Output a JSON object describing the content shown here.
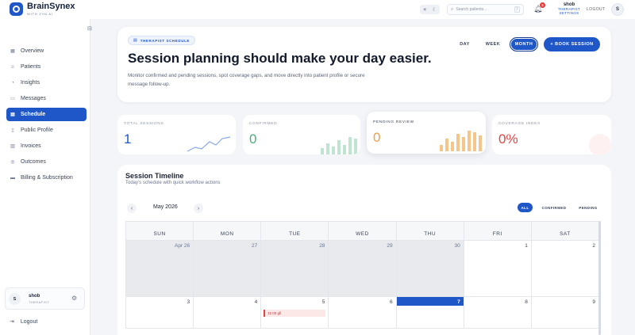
{
  "app": {
    "name": "BrainSynex",
    "tagline": "WITH ZYN AI"
  },
  "topbar": {
    "search_placeholder": "Search patients...",
    "search_shortcut": "/",
    "notification_count": "2",
    "user_name": "shob",
    "user_role": "THERAPIST SETTINGS",
    "logout_label": "LOGOUT",
    "avatar_initial": "S"
  },
  "sidebar": {
    "items": [
      {
        "label": "Overview",
        "icon": "grid-icon",
        "active": false
      },
      {
        "label": "Patients",
        "icon": "users-icon",
        "active": false
      },
      {
        "label": "Insights",
        "icon": "lightbulb-icon",
        "active": false
      },
      {
        "label": "Messages",
        "icon": "chat-icon",
        "active": false
      },
      {
        "label": "Schedule",
        "icon": "calendar-icon",
        "active": true
      },
      {
        "label": "Public Profile",
        "icon": "profile-icon",
        "active": false
      },
      {
        "label": "Invoices",
        "icon": "invoice-icon",
        "active": false
      },
      {
        "label": "Outcomes",
        "icon": "target-icon",
        "active": false
      },
      {
        "label": "Billing & Subscription",
        "icon": "card-icon",
        "active": false
      }
    ],
    "user": {
      "initial": "S",
      "name": "shob",
      "role": "THERAPIST"
    },
    "logout_label": "Logout"
  },
  "hero": {
    "tag": "THERAPIST SCHEDULE",
    "title": "Session planning should make your day easier.",
    "description": "Monitor confirmed and pending sessions, spot coverage gaps, and move directly into patient profile or secure message follow-up.",
    "range_buttons": [
      "DAY",
      "WEEK",
      "MONTH"
    ],
    "selected_range": "MONTH",
    "book_label": "+ BOOK SESSION"
  },
  "stats": [
    {
      "label": "TOTAL SESSIONS",
      "value": "1",
      "color": "#1f57c9"
    },
    {
      "label": "CONFIRMED",
      "value": "0",
      "color": "#4caf7a"
    },
    {
      "label": "PENDING REVIEW",
      "value": "0",
      "color": "#f0a04b"
    },
    {
      "label": "COVERAGE INDEX",
      "value": "0%",
      "color": "#e04646"
    }
  ],
  "timeline": {
    "title": "Session Timeline",
    "subtitle": "Today's schedule with quick workflow actions",
    "month": "May 2026",
    "filters": [
      "ALL",
      "CONFIRMED",
      "PENDING"
    ],
    "active_filter": "ALL",
    "weekdays": [
      "SUN",
      "MON",
      "TUE",
      "WED",
      "THU",
      "FRI",
      "SAT"
    ],
    "week1": [
      "Apr 26",
      "27",
      "28",
      "29",
      "30",
      "1",
      "2"
    ],
    "week2": [
      "3",
      "4",
      "5",
      "6",
      "7",
      "8",
      "9"
    ],
    "today": "7",
    "event": {
      "day": "5",
      "label": "11:00 gfi"
    }
  },
  "colors": {
    "accent": "#1f57c9",
    "confirmed": "#4caf7a",
    "pending": "#f0a04b",
    "coverage": "#e04646"
  }
}
